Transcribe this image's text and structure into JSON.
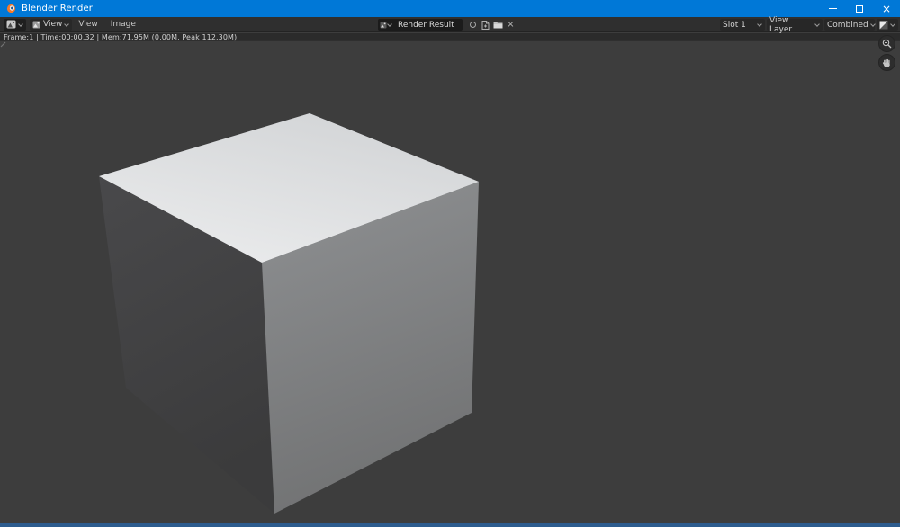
{
  "window": {
    "title": "Blender Render"
  },
  "header": {
    "mode_label": "View",
    "menus": {
      "view": "View",
      "image": "Image"
    },
    "image_name": "Render Result",
    "slot": "Slot 1",
    "view_layer": "View Layer",
    "render_pass": "Combined"
  },
  "stats": {
    "text": "Frame:1 | Time:00:00.32 | Mem:71.95M (0.00M, Peak 112.30M)"
  },
  "icons": {
    "titlebar": "blender-logo-icon",
    "editor_type": "image-editor-icon",
    "mode": "image-icon",
    "browse": "browse-image-icon",
    "datablock_buttons": [
      "pin-icon",
      "new-image-icon",
      "open-image-icon",
      "unlink-icon"
    ],
    "display_channels": "color-alpha-icon",
    "viewport_tools": [
      "zoom-icon",
      "pan-icon"
    ],
    "window_controls": [
      "minimize-icon",
      "maximize-icon",
      "close-icon"
    ]
  },
  "colors": {
    "titlebar": "#0078d7",
    "header_bg": "#2f2f2f",
    "stats_bg": "#2b2b2b",
    "viewport_bg": "#3d3d3d",
    "bottom_strip": "#2d5c8e",
    "cube_top_light": "#ebeced",
    "cube_top_dark": "#d2d4d6",
    "cube_right_light": "#8e9092",
    "cube_right_dark": "#717273",
    "cube_left_light": "#49494b",
    "cube_left_dark": "#3b3b3c"
  }
}
